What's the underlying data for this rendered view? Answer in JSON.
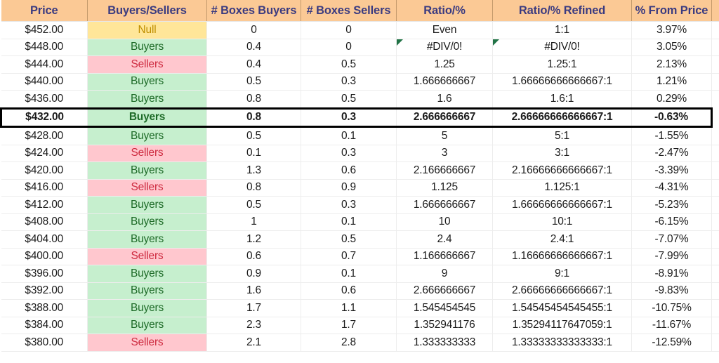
{
  "sheet": {
    "columns": [
      {
        "key": "price",
        "label": "Price"
      },
      {
        "key": "bs",
        "label": "Buyers/Sellers"
      },
      {
        "key": "boxes_buy",
        "label": "# Boxes Buyers"
      },
      {
        "key": "boxes_sell",
        "label": "# Boxes Sellers"
      },
      {
        "key": "ratio",
        "label": "Ratio/%"
      },
      {
        "key": "ratio_ref",
        "label": "Ratio/% Refined"
      },
      {
        "key": "from_price",
        "label": "% From Price"
      }
    ],
    "colors": {
      "header_bg": "#FBC995",
      "header_text": "#3B3B80",
      "buyers_bg": "#C6EFCE",
      "buyers_text": "#1E6B28",
      "sellers_bg": "#FFC7CE",
      "sellers_text": "#CE2B40",
      "null_bg": "#FFE699",
      "null_text": "#BF8F00",
      "error_flag": "#217346",
      "highlight_border": "#000000",
      "grid_line": "#EDEDED"
    },
    "rows": [
      {
        "price": "$452.00",
        "bs": "Null",
        "bs_kind": "null",
        "boxes_buy": "0",
        "boxes_sell": "0",
        "ratio": "Even",
        "ratio_ref": "1:1",
        "from_price": "3.97%",
        "highlight": false,
        "flag_ratio": false,
        "flag_ratio_ref": false
      },
      {
        "price": "$448.00",
        "bs": "Buyers",
        "bs_kind": "buyers",
        "boxes_buy": "0.4",
        "boxes_sell": "0",
        "ratio": "#DIV/0!",
        "ratio_ref": "#DIV/0!",
        "from_price": "3.05%",
        "highlight": false,
        "flag_ratio": true,
        "flag_ratio_ref": true
      },
      {
        "price": "$444.00",
        "bs": "Sellers",
        "bs_kind": "sellers",
        "boxes_buy": "0.4",
        "boxes_sell": "0.5",
        "ratio": "1.25",
        "ratio_ref": "1.25:1",
        "from_price": "2.13%",
        "highlight": false,
        "flag_ratio": false,
        "flag_ratio_ref": false
      },
      {
        "price": "$440.00",
        "bs": "Buyers",
        "bs_kind": "buyers",
        "boxes_buy": "0.5",
        "boxes_sell": "0.3",
        "ratio": "1.666666667",
        "ratio_ref": "1.66666666666667:1",
        "from_price": "1.21%",
        "highlight": false,
        "flag_ratio": false,
        "flag_ratio_ref": false
      },
      {
        "price": "$436.00",
        "bs": "Buyers",
        "bs_kind": "buyers",
        "boxes_buy": "0.8",
        "boxes_sell": "0.5",
        "ratio": "1.6",
        "ratio_ref": "1.6:1",
        "from_price": "0.29%",
        "highlight": false,
        "flag_ratio": false,
        "flag_ratio_ref": false
      },
      {
        "price": "$432.00",
        "bs": "Buyers",
        "bs_kind": "buyers",
        "boxes_buy": "0.8",
        "boxes_sell": "0.3",
        "ratio": "2.666666667",
        "ratio_ref": "2.66666666666667:1",
        "from_price": "-0.63%",
        "highlight": true,
        "flag_ratio": false,
        "flag_ratio_ref": false
      },
      {
        "price": "$428.00",
        "bs": "Buyers",
        "bs_kind": "buyers",
        "boxes_buy": "0.5",
        "boxes_sell": "0.1",
        "ratio": "5",
        "ratio_ref": "5:1",
        "from_price": "-1.55%",
        "highlight": false,
        "flag_ratio": false,
        "flag_ratio_ref": false
      },
      {
        "price": "$424.00",
        "bs": "Sellers",
        "bs_kind": "sellers",
        "boxes_buy": "0.1",
        "boxes_sell": "0.3",
        "ratio": "3",
        "ratio_ref": "3:1",
        "from_price": "-2.47%",
        "highlight": false,
        "flag_ratio": false,
        "flag_ratio_ref": false
      },
      {
        "price": "$420.00",
        "bs": "Buyers",
        "bs_kind": "buyers",
        "boxes_buy": "1.3",
        "boxes_sell": "0.6",
        "ratio": "2.166666667",
        "ratio_ref": "2.16666666666667:1",
        "from_price": "-3.39%",
        "highlight": false,
        "flag_ratio": false,
        "flag_ratio_ref": false
      },
      {
        "price": "$416.00",
        "bs": "Sellers",
        "bs_kind": "sellers",
        "boxes_buy": "0.8",
        "boxes_sell": "0.9",
        "ratio": "1.125",
        "ratio_ref": "1.125:1",
        "from_price": "-4.31%",
        "highlight": false,
        "flag_ratio": false,
        "flag_ratio_ref": false
      },
      {
        "price": "$412.00",
        "bs": "Buyers",
        "bs_kind": "buyers",
        "boxes_buy": "0.5",
        "boxes_sell": "0.3",
        "ratio": "1.666666667",
        "ratio_ref": "1.66666666666667:1",
        "from_price": "-5.23%",
        "highlight": false,
        "flag_ratio": false,
        "flag_ratio_ref": false
      },
      {
        "price": "$408.00",
        "bs": "Buyers",
        "bs_kind": "buyers",
        "boxes_buy": "1",
        "boxes_sell": "0.1",
        "ratio": "10",
        "ratio_ref": "10:1",
        "from_price": "-6.15%",
        "highlight": false,
        "flag_ratio": false,
        "flag_ratio_ref": false
      },
      {
        "price": "$404.00",
        "bs": "Buyers",
        "bs_kind": "buyers",
        "boxes_buy": "1.2",
        "boxes_sell": "0.5",
        "ratio": "2.4",
        "ratio_ref": "2.4:1",
        "from_price": "-7.07%",
        "highlight": false,
        "flag_ratio": false,
        "flag_ratio_ref": false
      },
      {
        "price": "$400.00",
        "bs": "Sellers",
        "bs_kind": "sellers",
        "boxes_buy": "0.6",
        "boxes_sell": "0.7",
        "ratio": "1.166666667",
        "ratio_ref": "1.16666666666667:1",
        "from_price": "-7.99%",
        "highlight": false,
        "flag_ratio": false,
        "flag_ratio_ref": false
      },
      {
        "price": "$396.00",
        "bs": "Buyers",
        "bs_kind": "buyers",
        "boxes_buy": "0.9",
        "boxes_sell": "0.1",
        "ratio": "9",
        "ratio_ref": "9:1",
        "from_price": "-8.91%",
        "highlight": false,
        "flag_ratio": false,
        "flag_ratio_ref": false
      },
      {
        "price": "$392.00",
        "bs": "Buyers",
        "bs_kind": "buyers",
        "boxes_buy": "1.6",
        "boxes_sell": "0.6",
        "ratio": "2.666666667",
        "ratio_ref": "2.66666666666667:1",
        "from_price": "-9.83%",
        "highlight": false,
        "flag_ratio": false,
        "flag_ratio_ref": false
      },
      {
        "price": "$388.00",
        "bs": "Buyers",
        "bs_kind": "buyers",
        "boxes_buy": "1.7",
        "boxes_sell": "1.1",
        "ratio": "1.545454545",
        "ratio_ref": "1.54545454545455:1",
        "from_price": "-10.75%",
        "highlight": false,
        "flag_ratio": false,
        "flag_ratio_ref": false
      },
      {
        "price": "$384.00",
        "bs": "Buyers",
        "bs_kind": "buyers",
        "boxes_buy": "2.3",
        "boxes_sell": "1.7",
        "ratio": "1.352941176",
        "ratio_ref": "1.35294117647059:1",
        "from_price": "-11.67%",
        "highlight": false,
        "flag_ratio": false,
        "flag_ratio_ref": false
      },
      {
        "price": "$380.00",
        "bs": "Sellers",
        "bs_kind": "sellers",
        "boxes_buy": "2.1",
        "boxes_sell": "2.8",
        "ratio": "1.333333333",
        "ratio_ref": "1.33333333333333:1",
        "from_price": "-12.59%",
        "highlight": false,
        "flag_ratio": false,
        "flag_ratio_ref": false
      }
    ]
  }
}
